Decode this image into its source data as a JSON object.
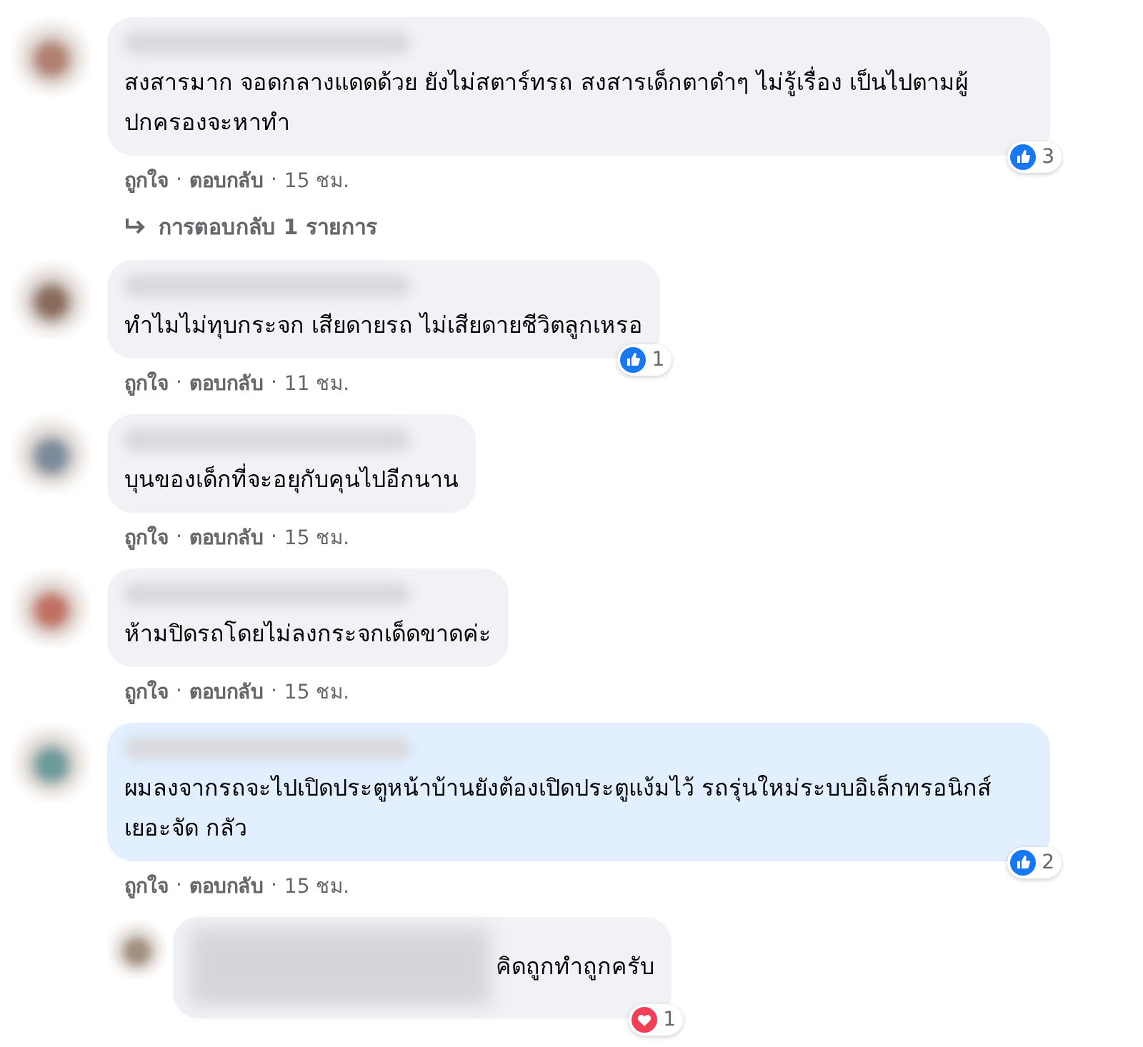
{
  "separator": "·",
  "comments": [
    {
      "kind": "comment",
      "highlighted": false,
      "text": "สงสารมาก จอดกลางแดดด้วย ยังไม่สตาร์ทรถ สงสารเด็กตาดำๆ ไม่รู้เรื่อง เป็นไปตามผู้ปกครองจะหาทำ",
      "reaction": {
        "kind": "like",
        "count": "3"
      },
      "actions": [
        "ถูกใจ",
        "ตอบกลับ"
      ],
      "time": "15 ชม.",
      "replies_link": "การตอบกลับ 1 รายการ"
    },
    {
      "kind": "comment",
      "highlighted": false,
      "text": "ทำไมไม่ทุบกระจก เสียดายรถ ไม่เสียดายชีวิตลูกเหรอ",
      "reaction": {
        "kind": "like",
        "count": "1"
      },
      "actions": [
        "ถูกใจ",
        "ตอบกลับ"
      ],
      "time": "11 ชม."
    },
    {
      "kind": "comment",
      "highlighted": false,
      "text": "บุนของเด็กที่จะอยุกับคุนไปอีกนาน",
      "actions": [
        "ถูกใจ",
        "ตอบกลับ"
      ],
      "time": "15 ชม."
    },
    {
      "kind": "comment",
      "highlighted": false,
      "text": "ห้ามปิดรถโดยไม่ลงกระจกเด็ดขาดค่ะ",
      "actions": [
        "ถูกใจ",
        "ตอบกลับ"
      ],
      "time": "15 ชม."
    },
    {
      "kind": "comment",
      "highlighted": true,
      "text": "ผมลงจากรถจะไปเปิดประตูหน้าบ้านยังต้องเปิดประตูแง้มไว้ รถรุ่นใหม่ระบบอิเล็กทรอนิกส์เยอะจัด กลัว",
      "reaction": {
        "kind": "like",
        "count": "2"
      },
      "actions": [
        "ถูกใจ",
        "ตอบกลับ"
      ],
      "time": "15 ชม."
    },
    {
      "kind": "reply",
      "highlighted": false,
      "text": "คิดถูกทำถูกครับ",
      "reaction": {
        "kind": "love",
        "count": "1"
      }
    }
  ]
}
